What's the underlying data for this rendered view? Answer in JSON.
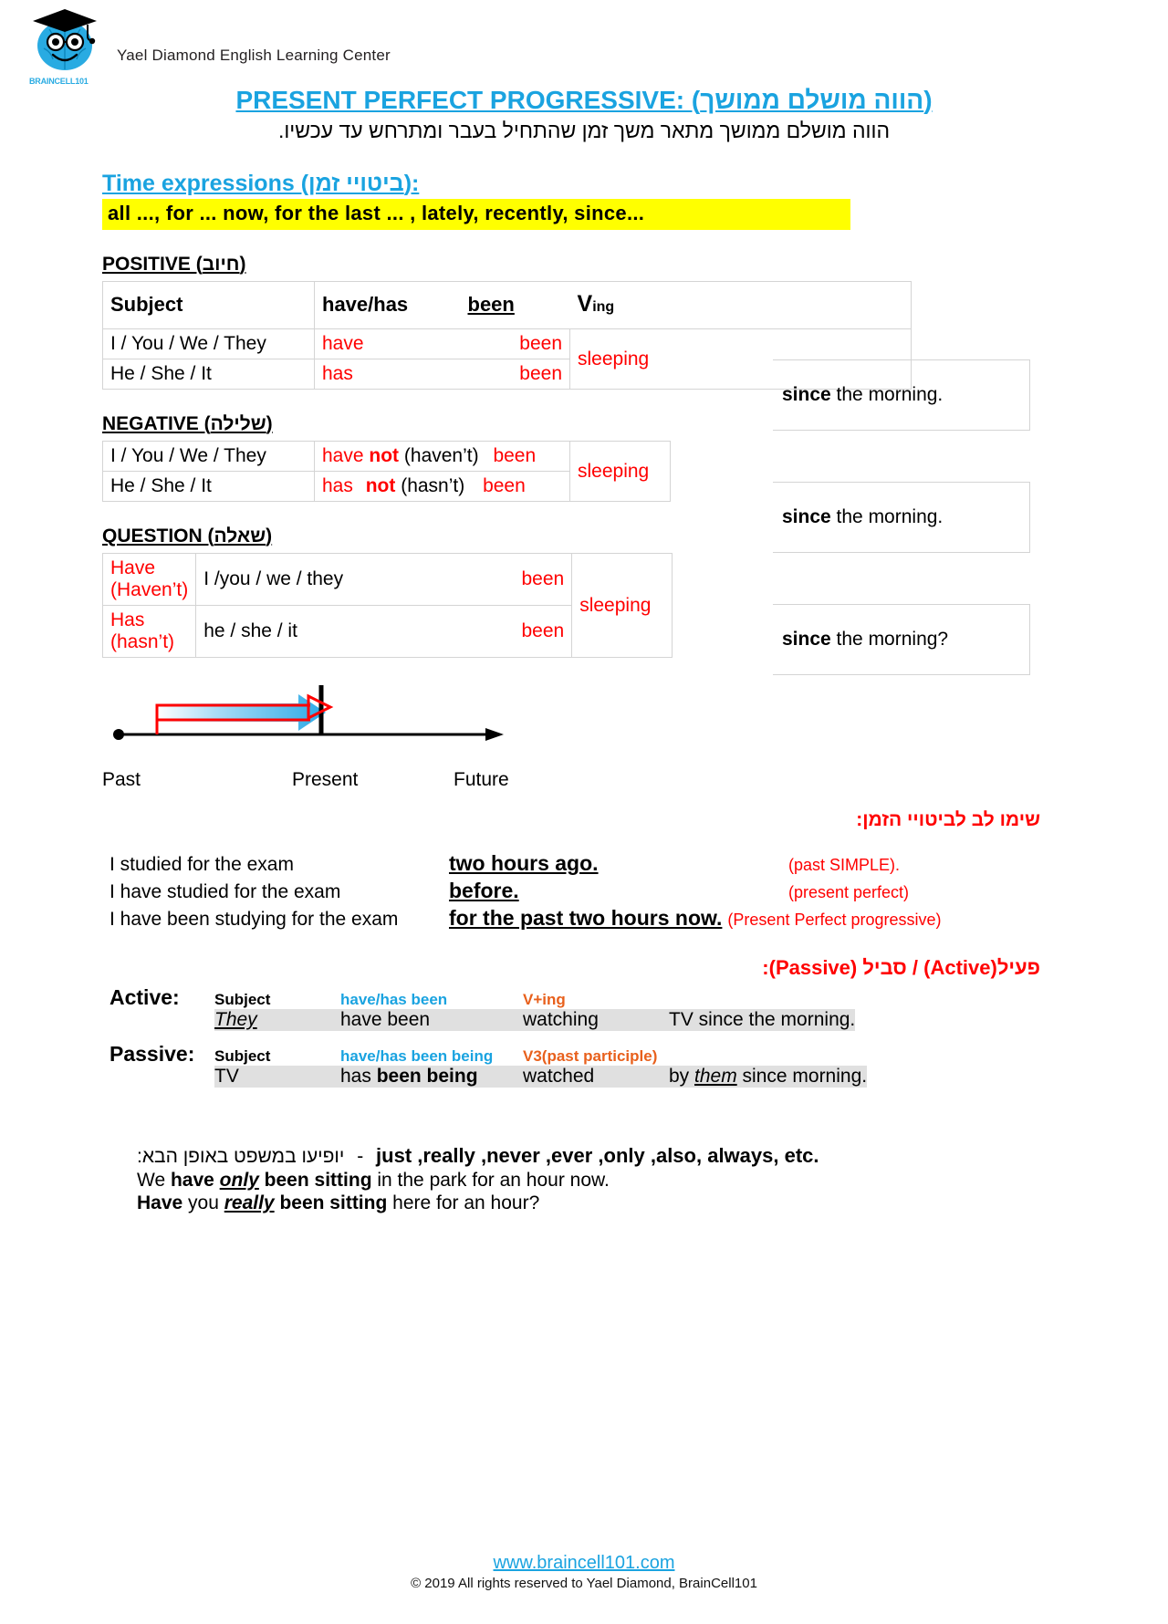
{
  "header": {
    "logo_text": "BRAINCELL101",
    "brand": "Yael Diamond English Learning Center"
  },
  "title": {
    "main": "PRESENT PERFECT PROGRESSIVE: (הווה מושלם ממושך)",
    "subtitle_he": "הווה מושלם ממושך מתאר משך זמן שהתחיל בעבר ומתרחש עד עכשיו."
  },
  "time_expressions": {
    "label": "Time expressions (ביטויי זמן):",
    "values": "all ...,  for ... now,  for the last ... ,  lately,   recently,    since..."
  },
  "positive": {
    "heading": "POSITIVE (חיוב)",
    "columns": [
      "Subject",
      "have/has",
      "been",
      "V",
      "ing"
    ],
    "rows": [
      {
        "subject": "I / You / We / They",
        "aux": "have",
        "been": "been"
      },
      {
        "subject": "He / She / It",
        "aux": "has",
        "been": "been"
      }
    ],
    "verb": "sleeping",
    "tail_bold": "since",
    "tail_rest": " the morning."
  },
  "negative": {
    "heading": "NEGATIVE (שלילה)",
    "rows": [
      {
        "subject": "I / You / We / They",
        "aux": "have",
        "not": "not",
        "contr": "(haven’t)",
        "been": "been"
      },
      {
        "subject": "He / She / It",
        "aux": "has",
        "not": "not",
        "contr": "(hasn’t)",
        "been": "been"
      }
    ],
    "verb": "sleeping",
    "tail_bold": "since",
    "tail_rest": " the morning."
  },
  "question": {
    "heading": "QUESTION (שאלה)",
    "rows": [
      {
        "aux": "Have (Haven’t)",
        "subject": "I /you / we / they",
        "been": "been"
      },
      {
        "aux": "Has  (hasn’t)",
        "subject": "he / she / it",
        "been": "been"
      }
    ],
    "verb": "sleeping",
    "tail_bold": "since",
    "tail_rest": " the morning?"
  },
  "timeline": {
    "past": "Past",
    "present": "Present",
    "future": "Future"
  },
  "note_he": "שימו לב לביטויי הזמן:",
  "examples": [
    {
      "sentence": "I studied for the exam",
      "time": "two hours ago.",
      "tense": "(past SIMPLE)."
    },
    {
      "sentence": "I have studied for the exam",
      "time": "before.",
      "tense": "(present perfect)"
    },
    {
      "sentence": "I have been studying for the exam",
      "time": "for the past two hours now.",
      "tense": "(Present Perfect progressive)"
    }
  ],
  "voice": {
    "title": "פעיל(Active) / סביל (Passive):",
    "active": {
      "label": "Active:",
      "keys": [
        "Subject",
        "have/has been",
        "V+ing"
      ],
      "example": [
        "They",
        "have been",
        "watching",
        "TV since the morning."
      ],
      "example_aux_bold": "have been"
    },
    "passive": {
      "label": "Passive:",
      "keys": [
        "Subject",
        "have/has been being",
        "V3(past participle)"
      ],
      "example": [
        "TV",
        "has been being",
        "watched",
        "by them since morning."
      ],
      "example_aux_plain": "has ",
      "example_aux_bold": "been being",
      "tail_pre": "by ",
      "tail_italic": "them",
      "tail_post": " since morning."
    }
  },
  "adverbs": {
    "he_note": "יופיעו במשפט באופן הבא:",
    "dash": "-",
    "list": "just ,really ,never ,ever ,only ,also, always, etc.",
    "line1": {
      "a": "We ",
      "b": "have ",
      "c": "only",
      "d": " been sitting",
      "e": " in the park for an hour now."
    },
    "line2": {
      "a": "Have",
      "b": " you ",
      "c": "really",
      "d": " been sitting",
      "e": " here for an hour?"
    }
  },
  "footer": {
    "site": "www.braincell101.com",
    "copyright": "© 2019 All rights reserved to Yael Diamond, BrainCell101"
  },
  "colors": {
    "accent": "#1aa3e0",
    "red": "#ff0000",
    "highlight": "#ffff00",
    "orange": "#e8601c",
    "gray_row": "#e0e0e0"
  }
}
